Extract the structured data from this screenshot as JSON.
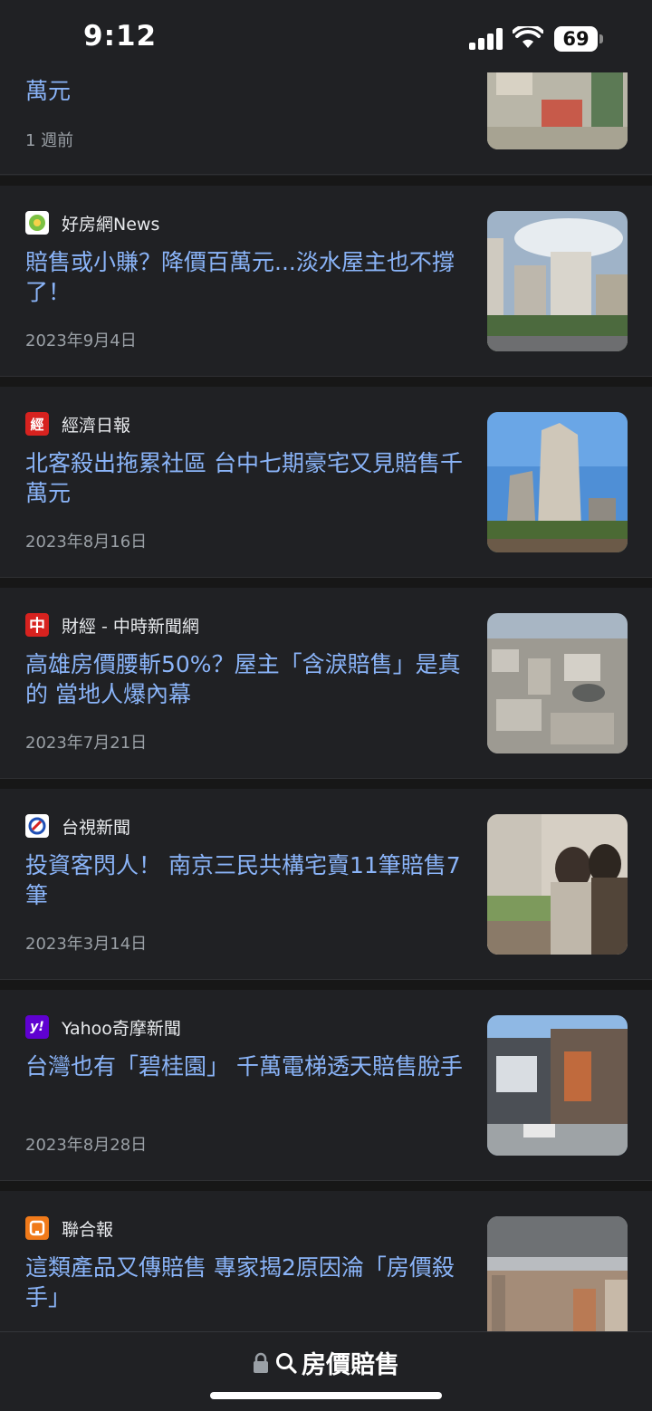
{
  "status_bar": {
    "time": "9:12",
    "battery": "69"
  },
  "partial_item": {
    "headline_tail": "萬元",
    "age": "1 週前"
  },
  "articles": [
    {
      "source": "好房網News",
      "logo_text": "",
      "headline": "賠售或小賺？降價百萬元...淡水屋主也不撐了！",
      "date": "2023年9月4日"
    },
    {
      "source": "經濟日報",
      "logo_text": "經",
      "headline": "北客殺出拖累社區 台中七期豪宅又見賠售千萬元",
      "date": "2023年8月16日"
    },
    {
      "source": "財經 - 中時新聞網",
      "logo_text": "中",
      "headline": "高雄房價腰斬50%？屋主「含淚賠售」是真的 當地人爆內幕",
      "date": "2023年7月21日"
    },
    {
      "source": "台視新聞",
      "logo_text": "",
      "headline": "投資客閃人！ 南京三民共構宅賣11筆賠售7筆",
      "date": "2023年3月14日"
    },
    {
      "source": "Yahoo奇摩新聞",
      "logo_text": "y!",
      "headline": "台灣也有「碧桂園」 千萬電梯透天賠售脫手",
      "date": "2023年8月28日"
    },
    {
      "source": "聯合報",
      "logo_text": "",
      "headline": "這類產品又傳賠售 專家揭2原因淪「房價殺手」",
      "date": ""
    }
  ],
  "bottom_bar": {
    "query": "房價賠售"
  },
  "colors": {
    "background": "#202124",
    "headline": "#8ab4f8",
    "meta": "#9aa0a6"
  }
}
